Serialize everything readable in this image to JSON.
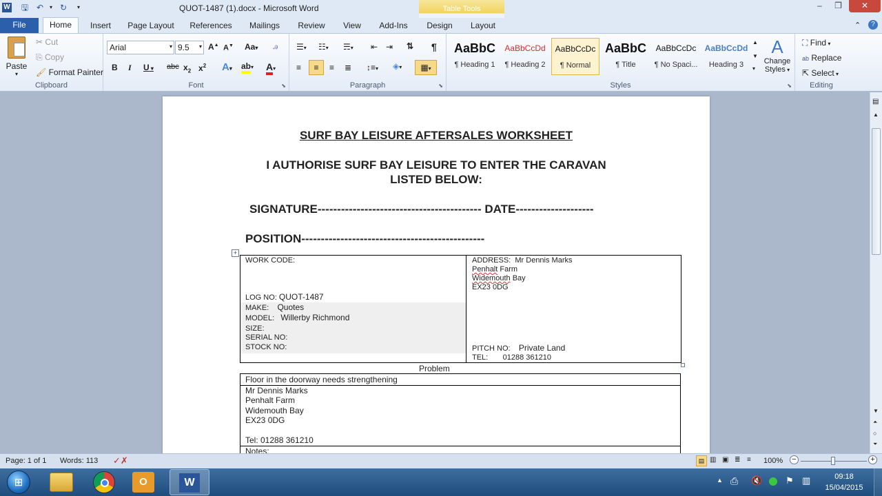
{
  "titlebar": {
    "title": "QUOT-1487 (1).docx - Microsoft Word",
    "contextual_group": "Table Tools",
    "min": "–",
    "max": "❐",
    "close": "✕"
  },
  "tabs": [
    "File",
    "Home",
    "Insert",
    "Page Layout",
    "References",
    "Mailings",
    "Review",
    "View",
    "Add-Ins",
    "Design",
    "Layout"
  ],
  "clipboard": {
    "paste": "Paste",
    "cut": "Cut",
    "copy": "Copy",
    "format_painter": "Format Painter",
    "label": "Clipboard"
  },
  "font": {
    "name": "Arial",
    "size": "9.5",
    "label": "Font"
  },
  "paragraph": {
    "label": "Paragraph"
  },
  "styles": {
    "label": "Styles",
    "items": [
      {
        "sample": "AaBbC",
        "name": "¶ Heading 1"
      },
      {
        "sample": "AaBbCcDd",
        "name": "¶ Heading 2"
      },
      {
        "sample": "AaBbCcDc",
        "name": "¶ Normal"
      },
      {
        "sample": "AaBbC",
        "name": "¶ Title"
      },
      {
        "sample": "AaBbCcDc",
        "name": "¶ No Spaci..."
      },
      {
        "sample": "AaBbCcDd",
        "name": "Heading 3"
      }
    ],
    "change_line1": "Change",
    "change_line2": "Styles"
  },
  "editing": {
    "find": "Find",
    "replace": "Replace",
    "select": "Select",
    "label": "Editing"
  },
  "document": {
    "h1": "SURF BAY LEISURE AFTERSALES WORKSHEET",
    "h2a": "I AUTHORISE SURF BAY LEISURE TO ENTER THE CARAVAN",
    "h2b": "LISTED BELOW:",
    "signature": "SIGNATURE------------------------------------------ DATE--------------------",
    "position": "POSITION-----------------------------------------------",
    "work_code": "WORK CODE:",
    "log_no_label": "LOG NO:",
    "log_no": "QUOT-1487",
    "make_label": "MAKE:",
    "make": "Quotes",
    "model_label": "MODEL:",
    "model": "Willerby Richmond",
    "size_label": "SIZE:",
    "serial_label": "SERIAL NO:",
    "stock_label": "STOCK NO:",
    "address_label": "ADDRESS:",
    "address_name": "Mr Dennis Marks",
    "address_l1a": "Penhalt",
    "address_l1b": " Farm",
    "address_l2a": "Widemouth",
    "address_l2b": " Bay",
    "address_l3": "EX23 0DG",
    "pitch_label": "PITCH NO:",
    "pitch": "Private Land",
    "tel_label": "TEL:",
    "tel": "01288 361210",
    "problem_header": "Problem",
    "problem": "Floor in the doorway needs strengthening",
    "contact_name": "Mr Dennis Marks",
    "contact_l1": "Penhalt Farm",
    "contact_l2": "Widemouth Bay",
    "contact_l3": "EX23 0DG",
    "contact_tel": "Tel:  01288 361210",
    "notes": "Notes:"
  },
  "status": {
    "page": "Page: 1 of 1",
    "words": "Words: 113",
    "zoom": "100%"
  },
  "tray": {
    "time": "09:18",
    "date": "15/04/2015"
  }
}
